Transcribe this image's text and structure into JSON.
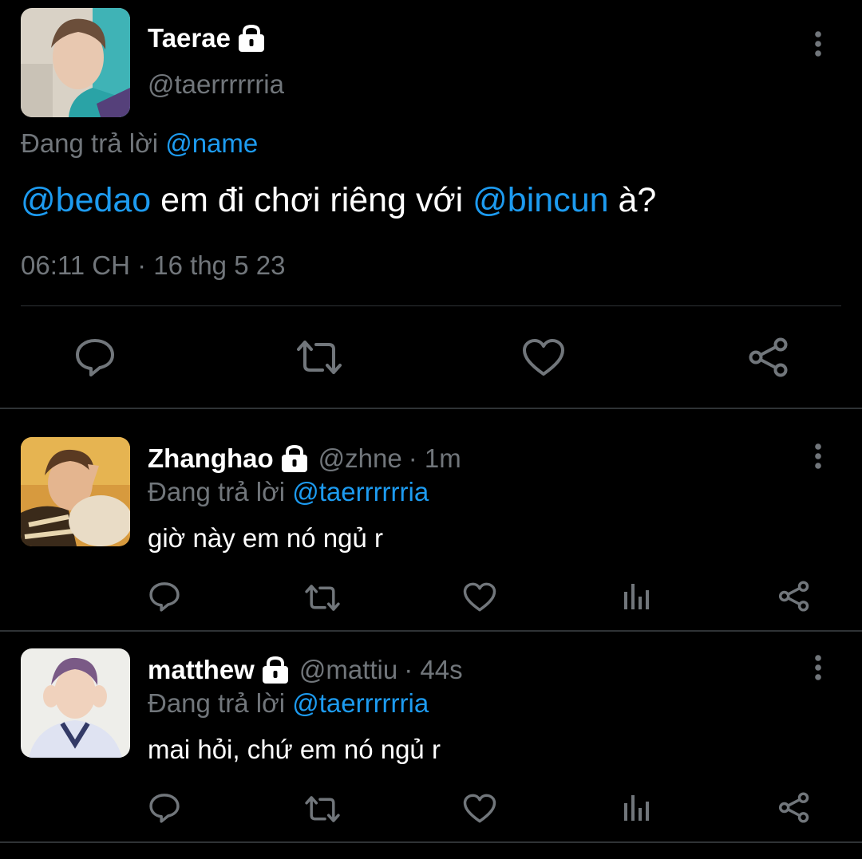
{
  "main_tweet": {
    "display_name": "Taerae",
    "handle": "@taerrrrrria",
    "reply_prefix": "Đang trả lời",
    "reply_to": "@name",
    "text_parts": [
      "@bedao",
      " em đi chơi riêng với ",
      "@bincun",
      " à?"
    ],
    "timestamp": "06:11 CH · 16 thg 5 23",
    "icons": [
      "comment-icon",
      "retweet-icon",
      "like-icon",
      "share-icon"
    ]
  },
  "replies": [
    {
      "display_name": "Zhanghao",
      "handle": "@zhne",
      "time": "· 1m",
      "reply_prefix": "Đang trả lời",
      "reply_to": "@taerrrrrria",
      "text": "giờ này em nó ngủ r"
    },
    {
      "display_name": "matthew",
      "handle": "@mattiu",
      "time": "· 44s",
      "reply_prefix": "Đang trả lời",
      "reply_to": "@taerrrrrria",
      "text": "mai hỏi, chứ em nó ngủ r"
    }
  ],
  "colors": {
    "accent": "#1d9bf0",
    "text": "#e7e9ea",
    "muted": "#71767b",
    "background": "#000000"
  }
}
